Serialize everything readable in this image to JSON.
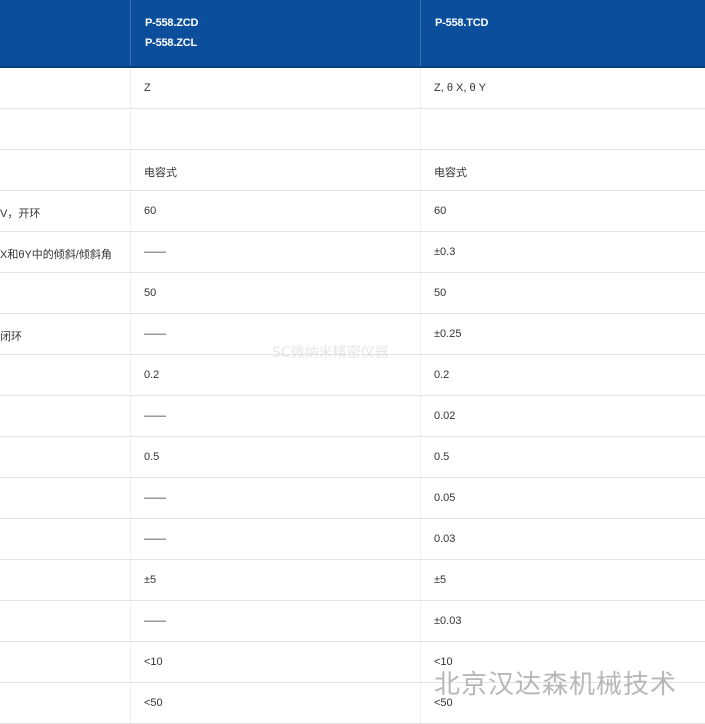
{
  "header": {
    "col1_line1": "P-558.ZCD",
    "col1_line2": "P-558.ZCL",
    "col2_line1": "P-558.TCD"
  },
  "rows": [
    {
      "label": "",
      "v1": "Z",
      "v2": "Z, θ X, θ Y"
    },
    {
      "label": "",
      "v1": "",
      "v2": ""
    },
    {
      "label": "",
      "v1": "电容式",
      "v2": "电容式"
    },
    {
      "label": "V，开环",
      "v1": "60",
      "v2": "60"
    },
    {
      "label": "X和θY中的倾斜/倾斜角",
      "v1": "——",
      "v2": "±0.3"
    },
    {
      "label": "",
      "v1": "50",
      "v2": "50"
    },
    {
      "label": "闭环",
      "v1": "——",
      "v2": "±0.25"
    },
    {
      "label": "",
      "v1": "0.2",
      "v2": "0.2"
    },
    {
      "label": "",
      "v1": "——",
      "v2": "0.02"
    },
    {
      "label": "",
      "v1": "0.5",
      "v2": "0.5"
    },
    {
      "label": "",
      "v1": "——",
      "v2": "0.05"
    },
    {
      "label": "",
      "v1": "——",
      "v2": "0.03"
    },
    {
      "label": "",
      "v1": "±5",
      "v2": "±5"
    },
    {
      "label": "",
      "v1": "——",
      "v2": "±0.03"
    },
    {
      "label": "",
      "v1": "<10",
      "v2": "<10"
    },
    {
      "label": "",
      "v1": "<50",
      "v2": "<50"
    }
  ],
  "watermarks": {
    "center": "SC微纳米精密仪器",
    "corner": "北京汉达森机械技术"
  }
}
